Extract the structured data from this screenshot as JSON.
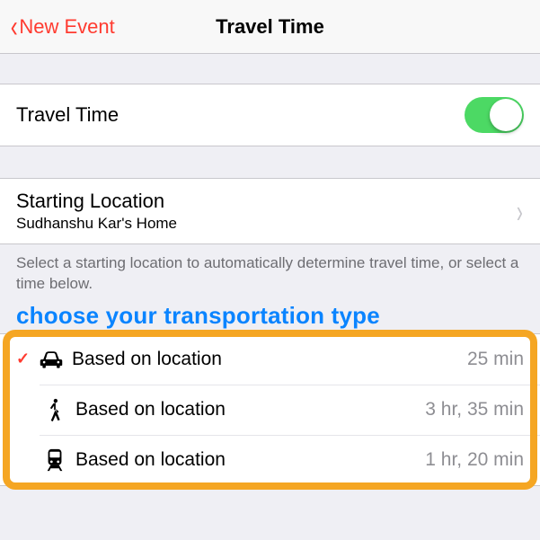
{
  "nav": {
    "back_label": "New Event",
    "title": "Travel Time"
  },
  "toggle_row": {
    "label": "Travel Time",
    "on": true
  },
  "starting_location": {
    "title": "Starting Location",
    "subtitle": "Sudhanshu Kar's Home"
  },
  "help_text": "Select a starting location to automatically determine travel time, or select a time below.",
  "annotation_text": "choose your transportation type",
  "transport": [
    {
      "icon": "car-icon",
      "label": "Based on location",
      "time": "25 min",
      "selected": true
    },
    {
      "icon": "walk-icon",
      "label": "Based on location",
      "time": "3 hr, 35 min",
      "selected": false
    },
    {
      "icon": "train-icon",
      "label": "Based on location",
      "time": "1 hr, 20 min",
      "selected": false
    }
  ]
}
